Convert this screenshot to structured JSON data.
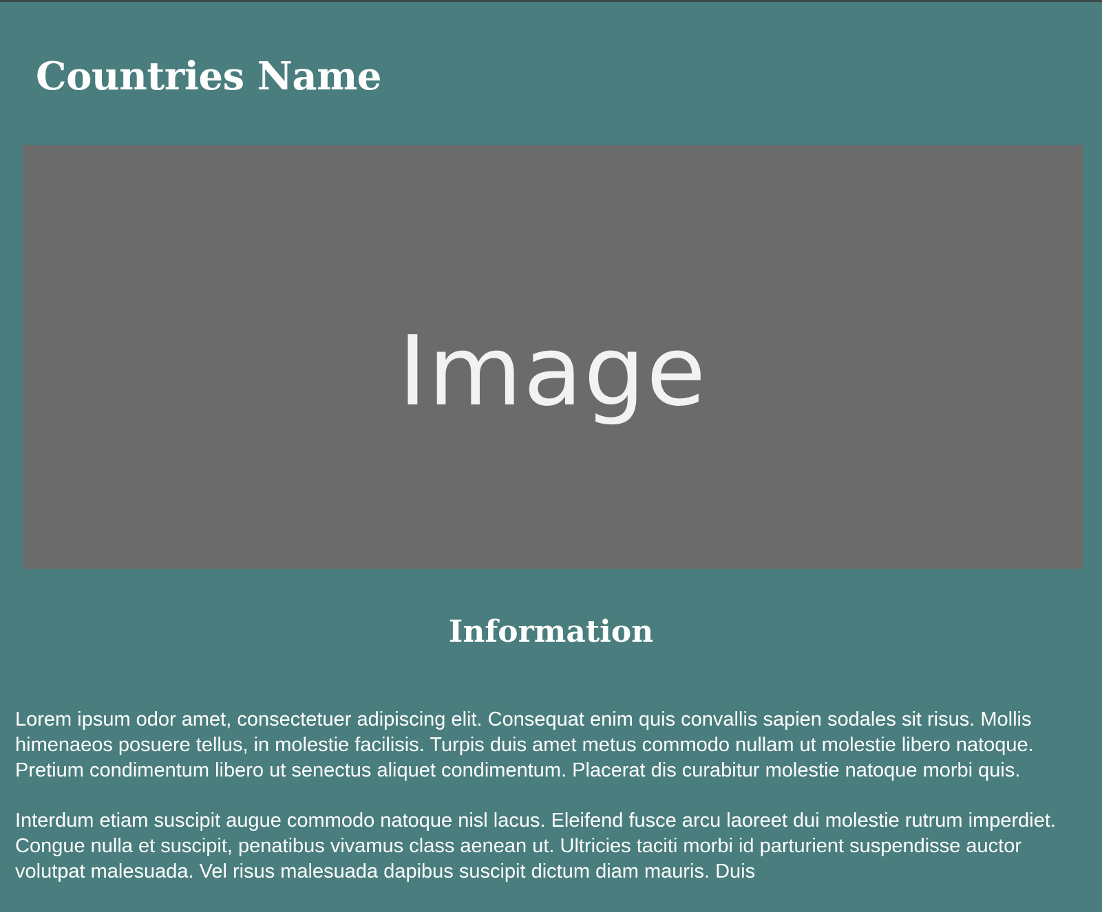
{
  "header": {
    "title": "Countries Name"
  },
  "hero": {
    "placeholder_label": "Image"
  },
  "info": {
    "heading": "Information",
    "paragraphs": [
      "Lorem ipsum odor amet, consectetuer adipiscing elit. Consequat enim quis convallis sapien sodales sit risus. Mollis himenaeos posuere tellus, in molestie facilisis. Turpis duis amet metus commodo nullam ut molestie libero natoque. Pretium condimentum libero ut senectus aliquet condimentum. Placerat dis curabitur molestie natoque morbi quis.",
      "Interdum etiam suscipit augue commodo natoque nisl lacus. Eleifend fusce arcu laoreet dui molestie rutrum imperdiet. Congue nulla et suscipit, penatibus vivamus class aenean ut. Ultricies taciti morbi id parturient suspendisse auctor volutpat malesuada. Vel risus malesuada dapibus suscipit dictum diam mauris. Duis"
    ]
  },
  "colors": {
    "background": "#4a7d7d",
    "image_placeholder": "#6b6b6b",
    "text": "#ffffff"
  }
}
